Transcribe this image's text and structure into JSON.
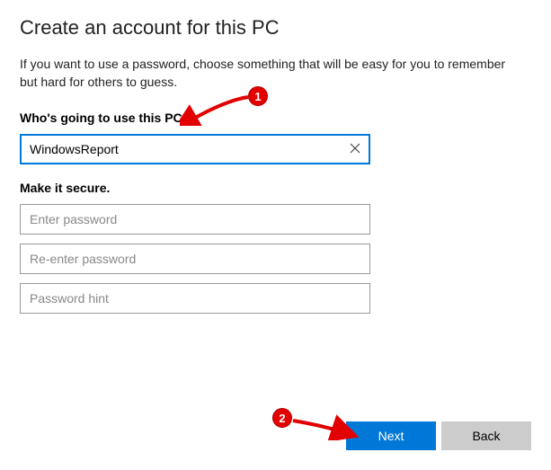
{
  "title": "Create an account for this PC",
  "intro": "If you want to use a password, choose something that will be easy for you to remember but hard for others to guess.",
  "who_label": "Who's going to use this PC?",
  "username_value": "WindowsReport",
  "secure_label": "Make it secure.",
  "password_placeholder": "Enter password",
  "reenter_placeholder": "Re-enter password",
  "hint_placeholder": "Password hint",
  "buttons": {
    "next": "Next",
    "back": "Back"
  },
  "annotations": {
    "one": "1",
    "two": "2"
  }
}
